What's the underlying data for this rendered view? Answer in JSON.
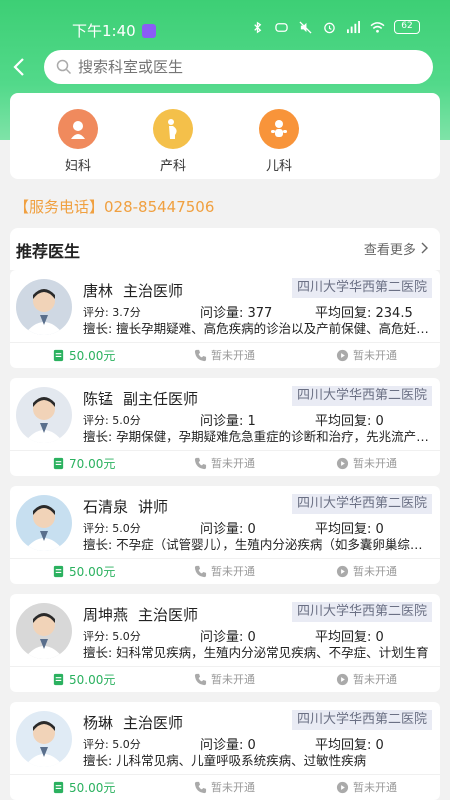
{
  "status": {
    "time": "下午1:40",
    "battery": "62"
  },
  "search": {
    "placeholder": "搜索科室或医生"
  },
  "categories": [
    {
      "label": "妇科",
      "icon": "woman-icon",
      "color": "#f08a5d"
    },
    {
      "label": "产科",
      "icon": "pregnant-icon",
      "color": "#f4c04a"
    },
    {
      "label": "儿科",
      "icon": "baby-icon",
      "color": "#f8943a"
    }
  ],
  "service_phone": "【服务电话】028-85447506",
  "recommend": {
    "title": "推荐医生",
    "more": "查看更多"
  },
  "labels": {
    "not_open": "暂未开通"
  },
  "doctors": [
    {
      "name": "唐林",
      "title": "主治医师",
      "hospital": "四川大学华西第二医院",
      "score": "评分: 3.7分",
      "count": "问诊量: 377",
      "reply": "平均回复: 234.5",
      "specialty": "擅长: 擅长孕期疑难、高危疾病的诊治以及产前保健、高危妊娠管理",
      "price": "50.00元"
    },
    {
      "name": "陈锰",
      "title": "副主任医师",
      "hospital": "四川大学华西第二医院",
      "score": "评分: 5.0分",
      "count": "问诊量: 1",
      "reply": "平均回复: 0",
      "specialty": "擅长: 孕期保健，孕期疑难危急重症的诊断和治疗，先兆流产的诊治",
      "price": "70.00元"
    },
    {
      "name": "石清泉",
      "title": "讲师",
      "hospital": "四川大学华西第二医院",
      "score": "评分: 5.0分",
      "count": "问诊量: 0",
      "reply": "平均回复: 0",
      "specialty": "擅长: 不孕症（试管婴儿），生殖内分泌疾病（如多囊卵巢综合征）",
      "price": "50.00元"
    },
    {
      "name": "周坤燕",
      "title": "主治医师",
      "hospital": "四川大学华西第二医院",
      "score": "评分: 5.0分",
      "count": "问诊量: 0",
      "reply": "平均回复: 0",
      "specialty": "擅长: 妇科常见疾病，生殖内分泌常见疾病、不孕症、计划生育",
      "price": "50.00元"
    },
    {
      "name": "杨琳",
      "title": "主治医师",
      "hospital": "四川大学华西第二医院",
      "score": "评分: 5.0分",
      "count": "问诊量: 0",
      "reply": "平均回复: 0",
      "specialty": "擅长: 儿科常见病、儿童呼吸系统疾病、过敏性疾病",
      "price": "50.00元"
    }
  ]
}
